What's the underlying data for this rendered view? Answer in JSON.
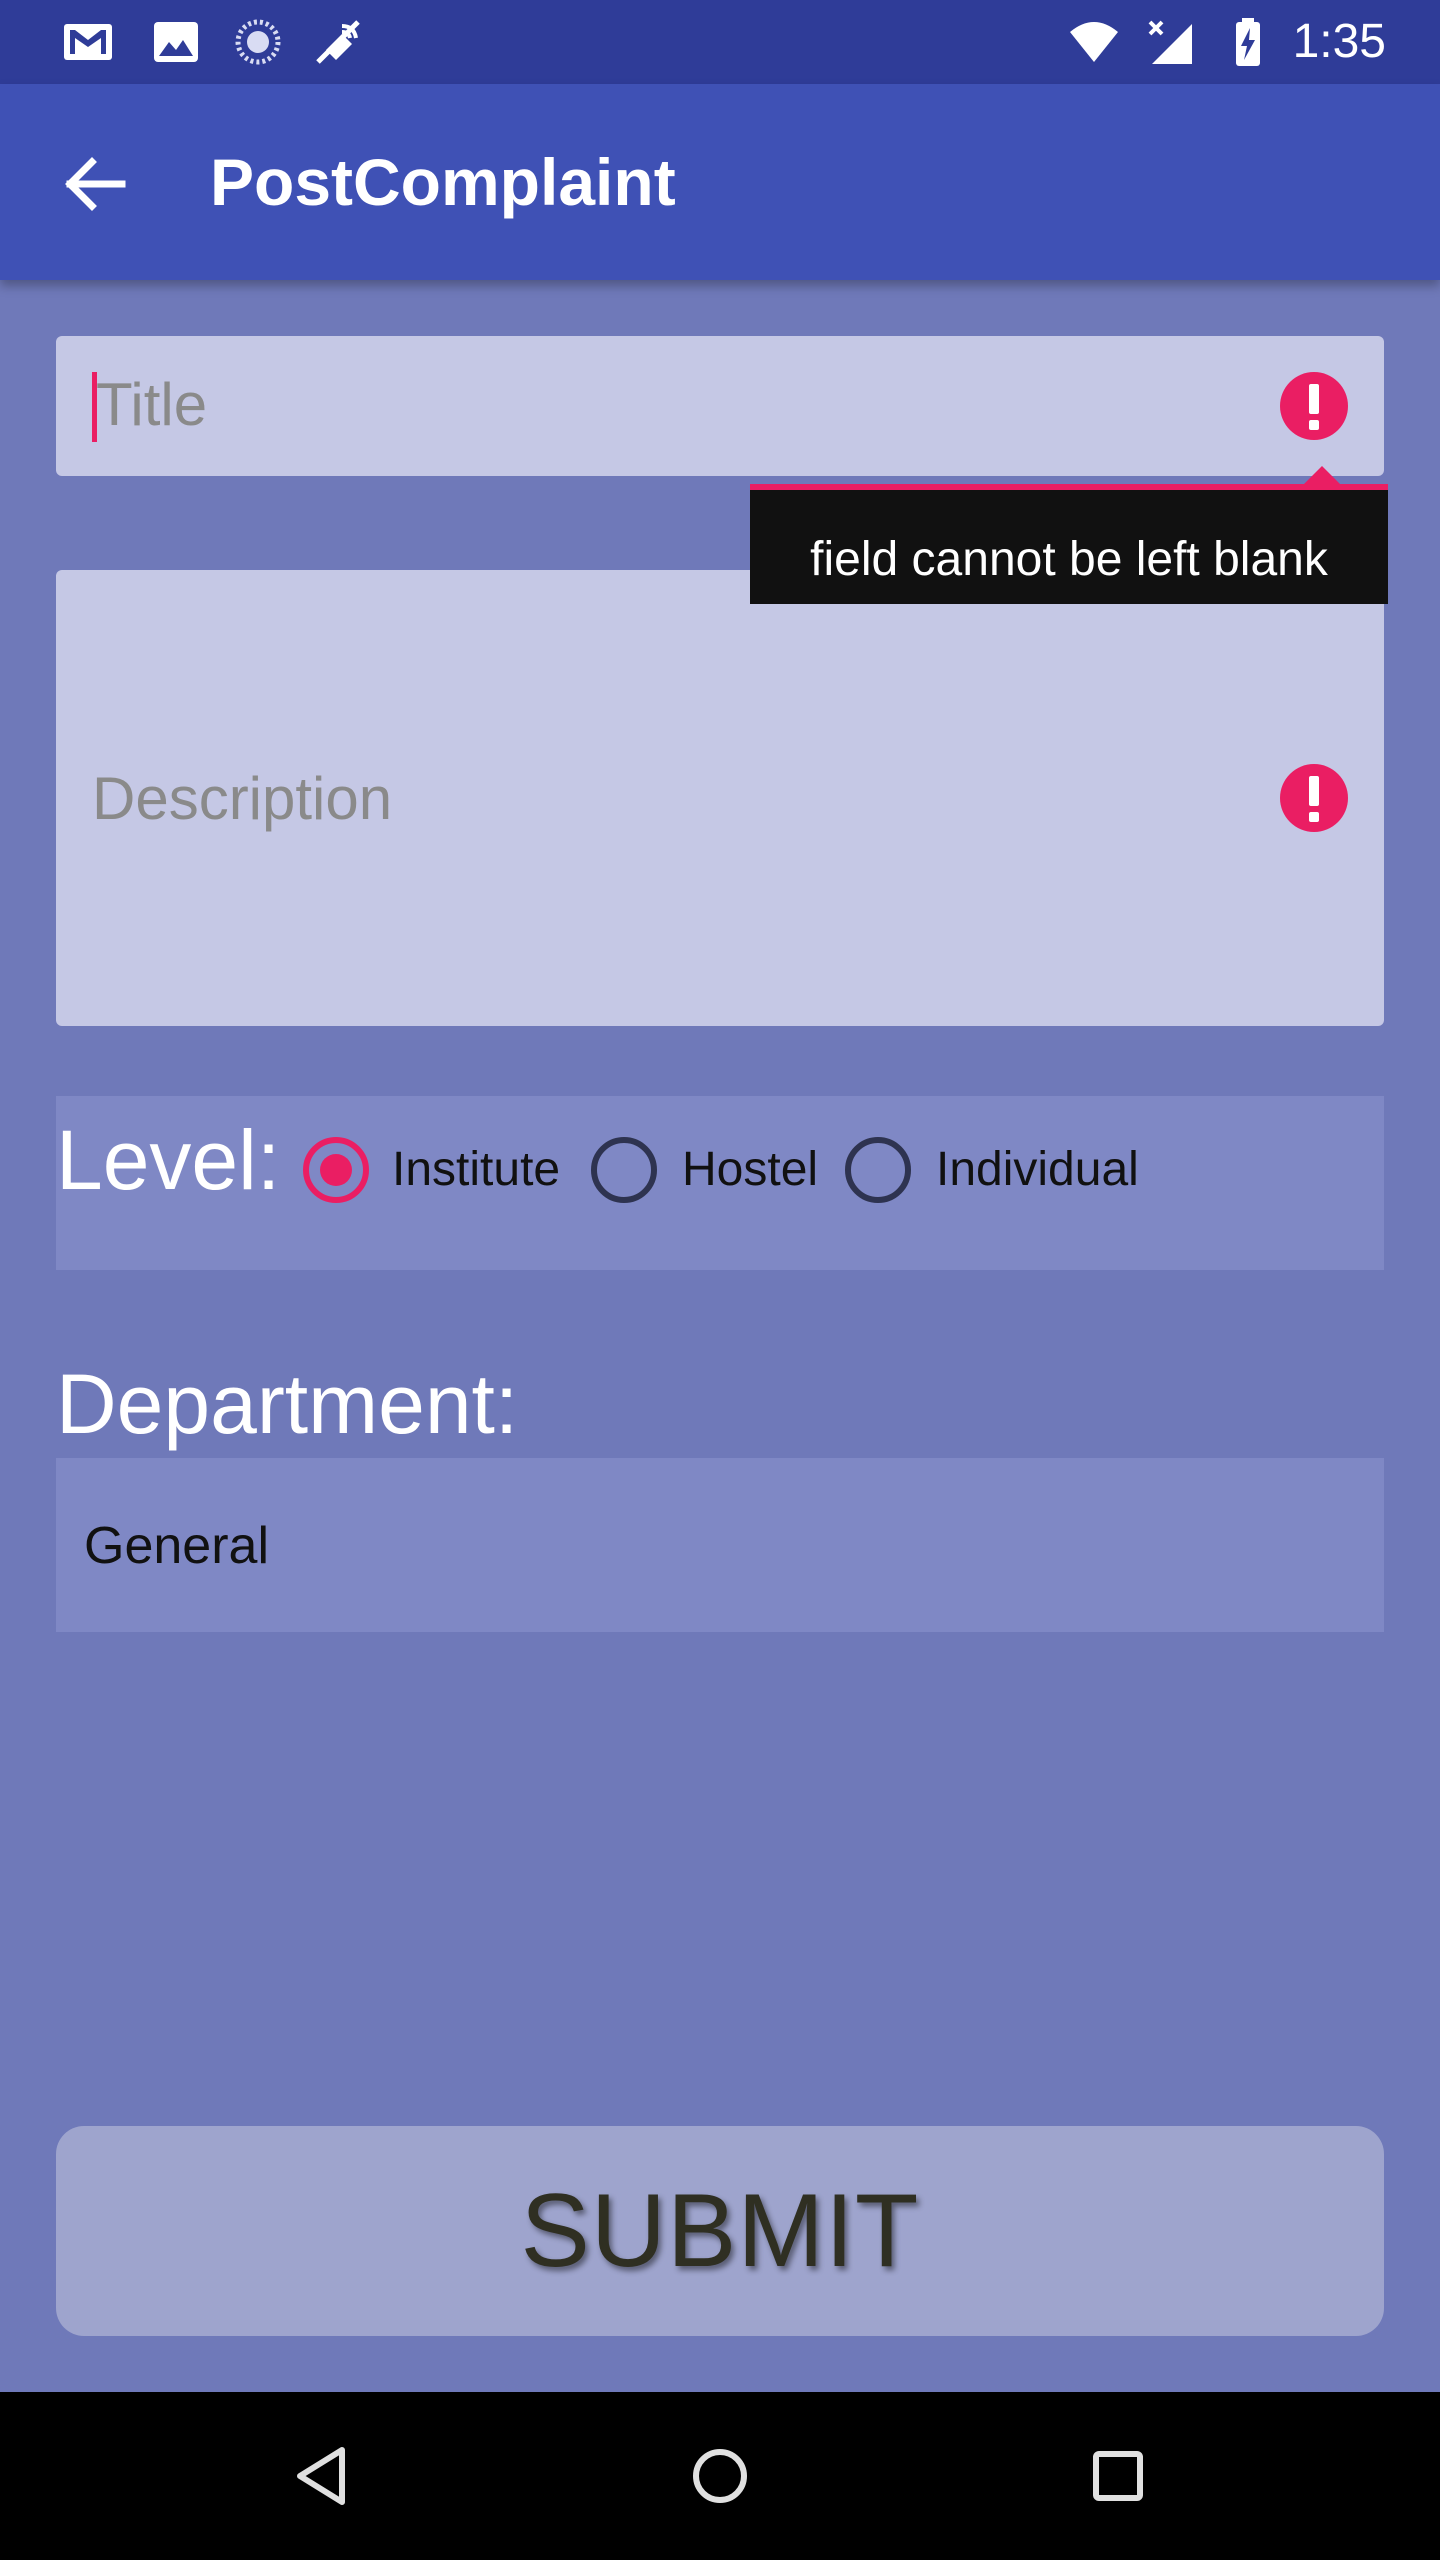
{
  "status_bar": {
    "time": "1:35",
    "left_icons": [
      "gmail-icon",
      "image-icon",
      "sync-spinner-icon",
      "satellite-off-icon"
    ],
    "right_icons": [
      "wifi-icon",
      "signal-no-data-icon",
      "battery-charging-icon"
    ]
  },
  "app_bar": {
    "title": "PostComplaint",
    "back_icon": "arrow-back-icon",
    "background_color": "#3f51b5"
  },
  "form": {
    "title_field": {
      "placeholder": "Title",
      "value": "",
      "error_icon": "error-exclamation-icon",
      "error_message": "field cannot be left blank"
    },
    "description_field": {
      "placeholder": "Description",
      "value": "",
      "error_icon": "error-exclamation-icon"
    },
    "level": {
      "label": "Level:",
      "options": [
        {
          "label": "Institute",
          "selected": true
        },
        {
          "label": "Hostel",
          "selected": false
        },
        {
          "label": "Individual",
          "selected": false
        }
      ]
    },
    "department": {
      "label": "Department:",
      "selected": "General"
    },
    "submit_label": "SUBMIT"
  },
  "nav_bar": {
    "icons": [
      "nav-back-icon",
      "nav-home-icon",
      "nav-recents-icon"
    ]
  },
  "colors": {
    "background": "#6f79b9",
    "status_bar": "#2f3c98",
    "accent": "#ea1e63",
    "field_background": "#c5c8e5",
    "panel_background": "#7f88c5",
    "button_background": "#9ea4cd"
  }
}
